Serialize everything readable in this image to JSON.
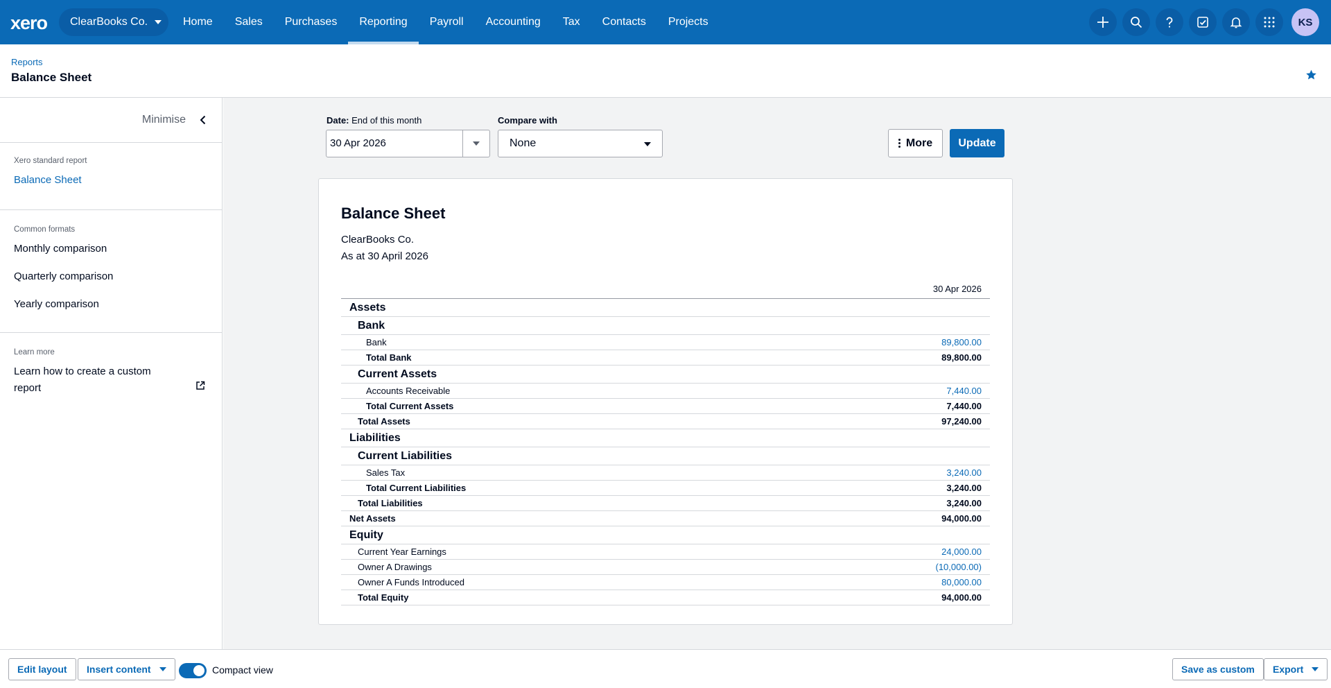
{
  "nav": {
    "logo": "xero",
    "org_name": "ClearBooks Co.",
    "items": [
      "Home",
      "Sales",
      "Purchases",
      "Reporting",
      "Payroll",
      "Accounting",
      "Tax",
      "Contacts",
      "Projects"
    ],
    "active_item": "Reporting",
    "right_icons": [
      "plus-icon",
      "search-icon",
      "help-icon",
      "task-check-icon",
      "bell-icon",
      "apps-grid-icon"
    ],
    "avatar_initials": "KS"
  },
  "header": {
    "breadcrumb": "Reports",
    "title": "Balance Sheet"
  },
  "sidebar": {
    "minimise_label": "Minimise",
    "standard_caption": "Xero standard report",
    "standard_report": "Balance Sheet",
    "formats_caption": "Common formats",
    "formats": [
      "Monthly comparison",
      "Quarterly comparison",
      "Yearly comparison"
    ],
    "learn_caption": "Learn more",
    "learn_link": "Learn how to create a custom report"
  },
  "filters": {
    "date_label": "Date:",
    "date_hint": "End of this month",
    "date_value": "30 Apr 2026",
    "compare_label": "Compare with",
    "compare_value": "None",
    "more_label": "More",
    "update_label": "Update"
  },
  "report": {
    "title": "Balance Sheet",
    "org": "ClearBooks Co.",
    "as_at": "As at 30 April 2026",
    "column_header": "30 Apr 2026",
    "rows": [
      {
        "label": "Assets",
        "amount": "",
        "type": "section",
        "indent": 0
      },
      {
        "label": "Bank",
        "amount": "",
        "type": "section",
        "indent": 1
      },
      {
        "label": "Bank",
        "amount": "89,800.00",
        "type": "line",
        "indent": 2
      },
      {
        "label": "Total Bank",
        "amount": "89,800.00",
        "type": "total",
        "indent": 2
      },
      {
        "label": "Current Assets",
        "amount": "",
        "type": "section",
        "indent": 1
      },
      {
        "label": "Accounts Receivable",
        "amount": "7,440.00",
        "type": "line",
        "indent": 2
      },
      {
        "label": "Total Current Assets",
        "amount": "7,440.00",
        "type": "total",
        "indent": 2
      },
      {
        "label": "Total Assets",
        "amount": "97,240.00",
        "type": "total",
        "indent": 1
      },
      {
        "label": "Liabilities",
        "amount": "",
        "type": "section",
        "indent": 0
      },
      {
        "label": "Current Liabilities",
        "amount": "",
        "type": "section",
        "indent": 1
      },
      {
        "label": "Sales Tax",
        "amount": "3,240.00",
        "type": "line",
        "indent": 2
      },
      {
        "label": "Total Current Liabilities",
        "amount": "3,240.00",
        "type": "total",
        "indent": 2
      },
      {
        "label": "Total Liabilities",
        "amount": "3,240.00",
        "type": "total",
        "indent": 1
      },
      {
        "label": "Net Assets",
        "amount": "94,000.00",
        "type": "total",
        "indent": 0
      },
      {
        "label": "Equity",
        "amount": "",
        "type": "section",
        "indent": 0
      },
      {
        "label": "Current Year Earnings",
        "amount": "24,000.00",
        "type": "line",
        "indent": 1
      },
      {
        "label": "Owner A Drawings",
        "amount": "(10,000.00)",
        "type": "line",
        "indent": 1
      },
      {
        "label": "Owner A Funds Introduced",
        "amount": "80,000.00",
        "type": "line",
        "indent": 1
      },
      {
        "label": "Total Equity",
        "amount": "94,000.00",
        "type": "total",
        "indent": 1
      }
    ]
  },
  "bottom": {
    "edit_layout": "Edit layout",
    "insert_content": "Insert content",
    "compact_view": "Compact view",
    "compact_on": true,
    "save_custom": "Save as custom",
    "export": "Export"
  },
  "colors": {
    "brand": "#0b6ab6",
    "link": "#0b6ab6",
    "text": "#000a1e"
  }
}
